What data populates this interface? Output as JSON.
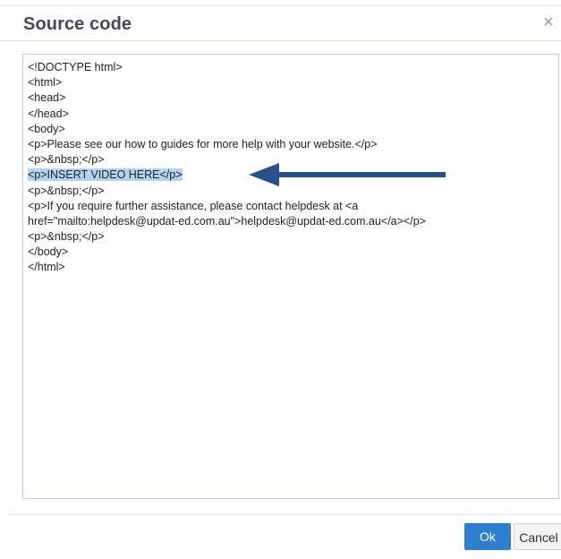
{
  "dialog": {
    "title": "Source code",
    "close_symbol": "×"
  },
  "editor": {
    "lines": [
      "<!DOCTYPE html>",
      "<html>",
      "<head>",
      "</head>",
      "<body>",
      "<p>Please see our how to guides for more help with your website.</p>",
      "<p>&nbsp;</p>",
      "<p>INSERT VIDEO HERE</p>",
      "<p>&nbsp;</p>",
      "<p>If you require further assistance, please contact helpdesk at <a",
      "href=\"mailto:helpdesk@updat-ed.com.au\">helpdesk@updat-ed.com.au</a></p>",
      "<p>&nbsp;</p>",
      "</body>",
      "</html>"
    ],
    "selected_line_index": 7
  },
  "annotation": {
    "arrow_color": "#2b4f8c",
    "arrow_icon": "arrow-left-icon"
  },
  "buttons": {
    "ok_label": "Ok",
    "cancel_label": "Cancel",
    "ok_color": "#2f7fd0"
  }
}
